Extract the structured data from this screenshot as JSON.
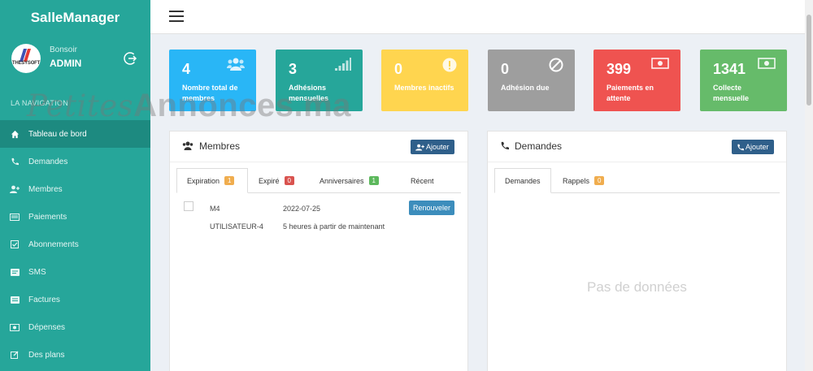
{
  "app": {
    "title": "SalleManager"
  },
  "user": {
    "greeting": "Bonsoir",
    "name": "ADMIN",
    "brand": "THESYSOFT"
  },
  "nav_header": "LA NAVIGATION",
  "menu": [
    {
      "label": "Tableau de bord",
      "icon": "home-icon"
    },
    {
      "label": "Demandes",
      "icon": "phone-icon"
    },
    {
      "label": "Membres",
      "icon": "user-plus-icon"
    },
    {
      "label": "Paiements",
      "icon": "money-icon"
    },
    {
      "label": "Abonnements",
      "icon": "check-square-icon"
    },
    {
      "label": "SMS",
      "icon": "sms-icon"
    },
    {
      "label": "Factures",
      "icon": "invoice-icon"
    },
    {
      "label": "Dépenses",
      "icon": "expense-icon"
    },
    {
      "label": "Des plans",
      "icon": "edit-icon"
    }
  ],
  "stats": [
    {
      "value": "4",
      "label": "Nombre total de membres",
      "color": "#29b6f6",
      "icon": "users-icon"
    },
    {
      "value": "3",
      "label": "Adhésions mensuelles",
      "color": "#26a69a",
      "icon": "signal-icon"
    },
    {
      "value": "0",
      "label": "Membres inactifs",
      "color": "#ffd54f",
      "icon": "exclamation-icon"
    },
    {
      "value": "0",
      "label": "Adhésion due",
      "color": "#9e9e9e",
      "icon": "ban-icon"
    },
    {
      "value": "399",
      "label": "Paiements en attente",
      "color": "#ef5350",
      "icon": "cash-icon"
    },
    {
      "value": "1341",
      "label": "Collecte mensuelle",
      "color": "#66bb6a",
      "icon": "cash-icon"
    }
  ],
  "members_panel": {
    "title": "Membres",
    "add_label": "Ajouter",
    "tabs": [
      {
        "label": "Expiration",
        "badge": "1",
        "badge_color": "#f0ad4e"
      },
      {
        "label": "Expiré",
        "badge": "0",
        "badge_color": "#d9534f"
      },
      {
        "label": "Anniversaires",
        "badge": "1",
        "badge_color": "#5cb85c"
      },
      {
        "label": "Récent",
        "badge": "",
        "badge_color": ""
      }
    ],
    "row": {
      "code": "M4",
      "date": "2022-07-25",
      "user": "UTILISATEUR-4",
      "relative": "5 heures à partir de maintenant",
      "renew_label": "Renouveler"
    }
  },
  "requests_panel": {
    "title": "Demandes",
    "add_label": "Ajouter",
    "tabs": [
      {
        "label": "Demandes",
        "badge": ""
      },
      {
        "label": "Rappels",
        "badge": "0",
        "badge_color": "#f0ad4e"
      }
    ],
    "empty": "Pas de données"
  },
  "watermark": {
    "part1": "Petites",
    "part2": "Annonces.ma"
  }
}
